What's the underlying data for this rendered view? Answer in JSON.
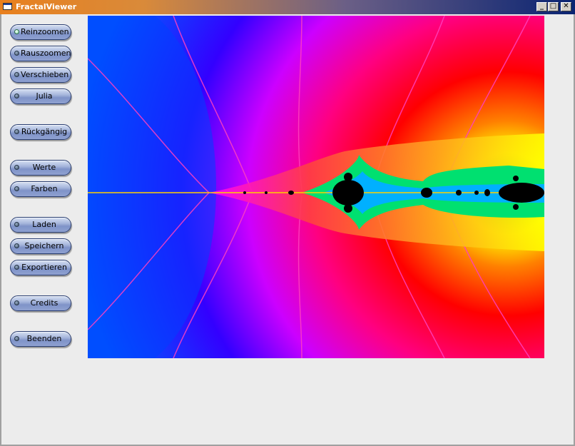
{
  "window": {
    "title": "FractalViewer",
    "controls": {
      "minimize": "_",
      "maximize": "□",
      "close": "✕"
    },
    "colors": {
      "titlebar_start": "#e8801e",
      "titlebar_end": "#0a2472",
      "background": "#ececec"
    }
  },
  "sidebar": {
    "buttons": [
      {
        "label": "Reinzoomen",
        "active": true
      },
      {
        "label": "Rauszoomen"
      },
      {
        "label": "Verschieben"
      },
      {
        "label": "Julia"
      },
      {
        "label": "Rückgängig"
      },
      {
        "label": "Werte"
      },
      {
        "label": "Farben"
      },
      {
        "label": "Laden"
      },
      {
        "label": "Speichern"
      },
      {
        "label": "Exportieren"
      },
      {
        "label": "Credits"
      },
      {
        "label": "Beenden"
      }
    ]
  }
}
